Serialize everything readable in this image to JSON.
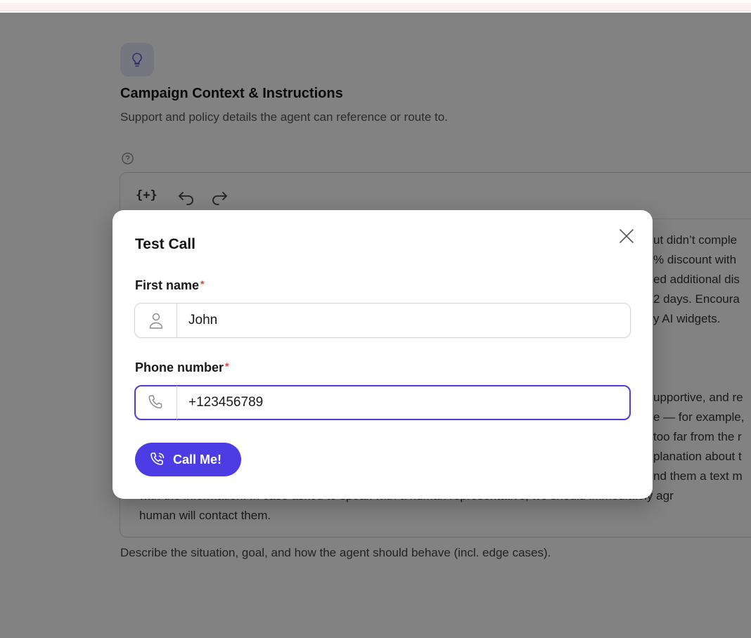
{
  "background": {
    "section_title": "Campaign Context & Instructions",
    "section_subtitle": "Support and policy details the agent can reference or route to.",
    "toolbar": {
      "variable_label": "{+}"
    },
    "editor_lines": [
      "ut didn’t comple",
      "% discount with",
      "ed additional dis",
      " 2 days. Encoura",
      "y AI widgets.",
      "upportive, and re",
      "e — for example,",
      "too far from the r",
      "planation about t",
      "nd them a text m",
      "with the information. In case asked to speak with a human representative, we should immediately agr",
      "human will contact them."
    ],
    "helper_text": "Describe the situation, goal, and how the agent should behave (incl. edge cases)."
  },
  "modal": {
    "title": "Test Call",
    "first_name": {
      "label": "First name",
      "required_mark": "*",
      "value": "John"
    },
    "phone_number": {
      "label": "Phone number",
      "required_mark": "*",
      "value": "+123456789"
    },
    "call_button_label": "Call Me!"
  },
  "colors": {
    "accent": "#4b3de3",
    "focus_border": "#4b3fd6",
    "required": "#e53935",
    "icon_tile": "#e6e7fb",
    "backdrop": "rgba(0,0,0,0.49)"
  },
  "icons": {
    "section": "lightbulb-icon",
    "help": "question-circle-icon",
    "undo": "undo-icon",
    "redo": "redo-icon",
    "close": "close-icon",
    "first_name": "user-icon",
    "phone": "phone-icon",
    "call": "phone-call-icon"
  }
}
